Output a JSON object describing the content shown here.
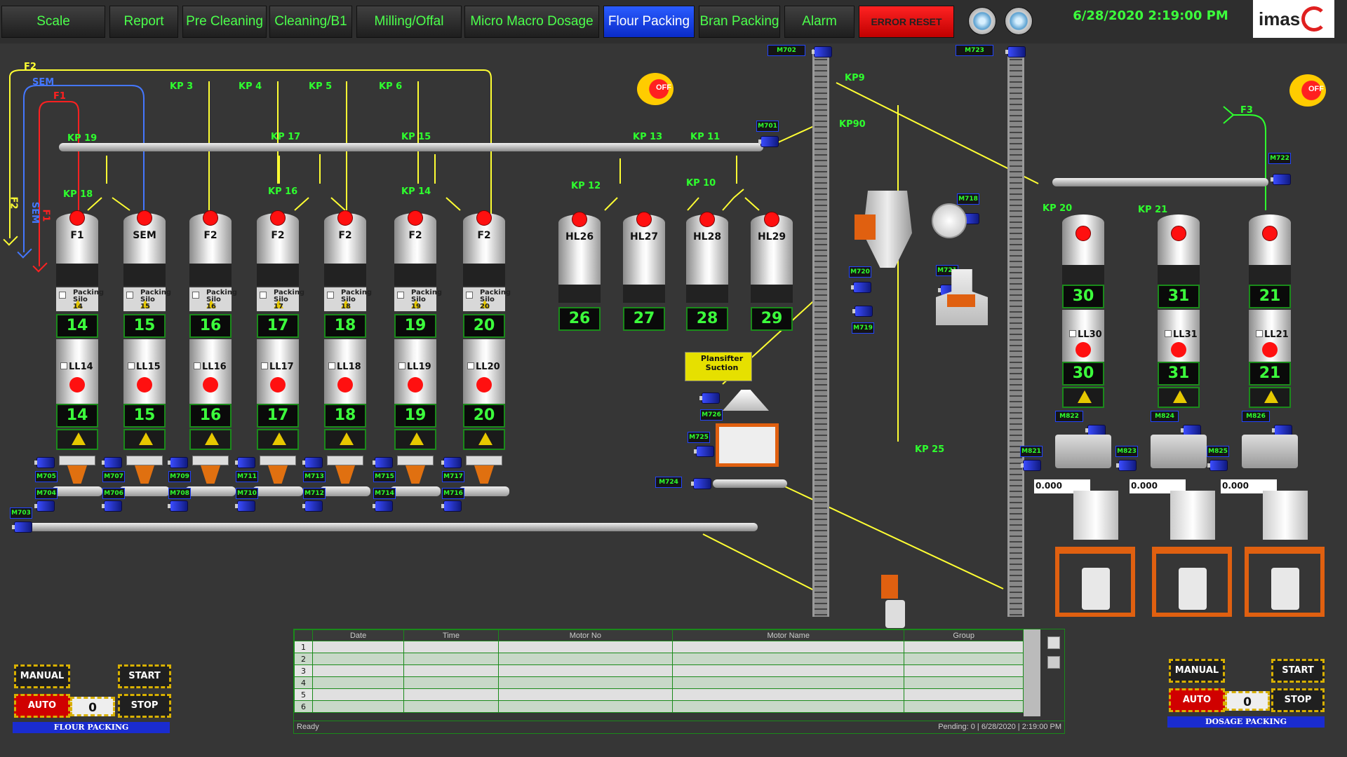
{
  "nav": {
    "tabs": [
      {
        "label": "Scale"
      },
      {
        "label": "Report"
      },
      {
        "label": "Pre Cleaning"
      },
      {
        "label": "Cleaning/B1"
      },
      {
        "label": "Milling/Offal"
      },
      {
        "label": "Micro Macro Dosage"
      },
      {
        "label": "Flour Packing",
        "active": true
      },
      {
        "label": "Bran Packing"
      },
      {
        "label": "Alarm"
      },
      {
        "label": "ERROR RESET"
      }
    ]
  },
  "datetime": "6/28/2020 2:19:00 PM",
  "logo": "imas",
  "off_label": "OFF",
  "kps": [
    "F2",
    "SEM",
    "F1",
    "KP 3",
    "KP 4",
    "KP 5",
    "KP 6",
    "KP 19",
    "KP 17",
    "KP 15",
    "KP 13",
    "KP 11",
    "KP 18",
    "KP 16",
    "KP 14",
    "KP 12",
    "KP 10",
    "KP 20",
    "KP 21",
    "KP9",
    "KP90",
    "KP 25",
    "F3",
    "SEM",
    "F1",
    "F2"
  ],
  "silos": [
    {
      "name": "F1",
      "pack": "Packing Silo 14",
      "num": "14",
      "ll": "LL14",
      "num2": "14",
      "m1": "M705",
      "m2": "M704"
    },
    {
      "name": "SEM",
      "pack": "Packing Silo 15",
      "num": "15",
      "ll": "LL15",
      "num2": "15",
      "m1": "M707",
      "m2": "M706"
    },
    {
      "name": "F2",
      "pack": "Packing Silo 16",
      "num": "16",
      "ll": "LL16",
      "num2": "16",
      "m1": "M709",
      "m2": "M708"
    },
    {
      "name": "F2",
      "pack": "Packing Silo 17",
      "num": "17",
      "ll": "LL17",
      "num2": "17",
      "m1": "M711",
      "m2": "M710"
    },
    {
      "name": "F2",
      "pack": "Packing Silo 18",
      "num": "18",
      "ll": "LL18",
      "num2": "18",
      "m1": "M713",
      "m2": "M712"
    },
    {
      "name": "F2",
      "pack": "Packing Silo 19",
      "num": "19",
      "ll": "LL19",
      "num2": "19",
      "m1": "M715",
      "m2": "M714"
    },
    {
      "name": "F2",
      "pack": "Packing Silo 20",
      "num": "20",
      "ll": "LL20",
      "num2": "20",
      "m1": "M717",
      "m2": "M716"
    }
  ],
  "hl": [
    {
      "name": "HL26",
      "num": "26"
    },
    {
      "name": "HL27",
      "num": "27"
    },
    {
      "name": "HL28",
      "num": "28"
    },
    {
      "name": "HL29",
      "num": "29"
    }
  ],
  "dosage": [
    {
      "num": "30",
      "ll": "LL30",
      "num2": "30",
      "m": "M822",
      "m2": "M821",
      "val": "0.000"
    },
    {
      "num": "31",
      "ll": "LL31",
      "num2": "31",
      "m": "M824",
      "m2": "M823",
      "val": "0.000"
    },
    {
      "num": "21",
      "ll": "LL21",
      "num2": "21",
      "m": "M826",
      "m2": "M825",
      "val": "0.000"
    }
  ],
  "motors": {
    "m703": "M703",
    "m701": "M701",
    "m702": "M702",
    "m723": "M723",
    "m722": "M722",
    "m718": "M718",
    "m720": "M720",
    "m721": "M721",
    "m719": "M719",
    "m726": "M726",
    "m725": "M725",
    "m724": "M724"
  },
  "plansifter": "Plansifter Suction",
  "table": {
    "headers": [
      "Date",
      "Time",
      "Motor No",
      "Motor Name",
      "Group"
    ],
    "rows": [
      "1",
      "2",
      "3",
      "4",
      "5",
      "6"
    ],
    "status": "Ready",
    "pending": "Pending: 0",
    "date": "6/28/2020",
    "time": "2:19:00 PM"
  },
  "controls_left": {
    "manual": "MANUAL",
    "start": "START",
    "auto": "AUTO",
    "stop": "STOP",
    "count": "0",
    "title": "FLOUR PACKING"
  },
  "controls_right": {
    "manual": "MANUAL",
    "start": "START",
    "auto": "AUTO",
    "stop": "STOP",
    "count": "0",
    "title": "DOSAGE PACKING"
  },
  "colors": {
    "green": "#2eff2e",
    "wire_yellow": "#ffff33",
    "wire_blue": "#4477ff",
    "wire_red": "#ff2020",
    "accent_blue": "#0a2bc8"
  }
}
